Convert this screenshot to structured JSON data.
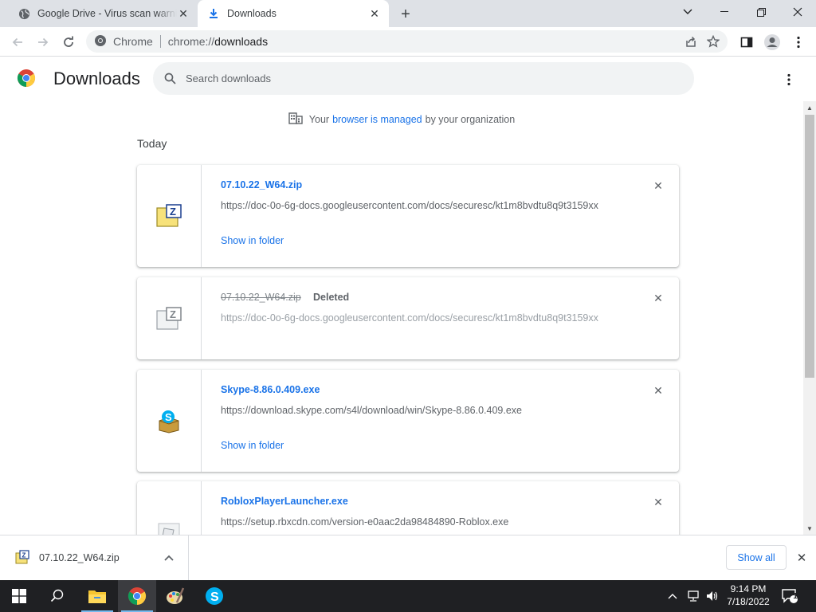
{
  "tabs": [
    {
      "title": "Google Drive - Virus scan warning",
      "icon": "globe-icon"
    },
    {
      "title": "Downloads",
      "icon": "download-icon"
    }
  ],
  "omnibox": {
    "site_label": "Chrome",
    "url_scheme": "chrome://",
    "url_host": "downloads"
  },
  "page": {
    "title": "Downloads",
    "search_placeholder": "Search downloads"
  },
  "managed": {
    "prefix": "Your",
    "link": "browser is managed",
    "suffix": "by your organization"
  },
  "section": "Today",
  "downloads": [
    {
      "name": "07.10.22_W64.zip",
      "url": "https://doc-0o-6g-docs.googleusercontent.com/docs/securesc/kt1m8bvdtu8q9t3159xx",
      "action": "Show in folder",
      "icon": "zip-file-icon"
    },
    {
      "name": "07.10.22_W64.zip",
      "status": "Deleted",
      "url": "https://doc-0o-6g-docs.googleusercontent.com/docs/securesc/kt1m8bvdtu8q9t3159xx",
      "icon": "zip-file-icon"
    },
    {
      "name": "Skype-8.86.0.409.exe",
      "url": "https://download.skype.com/s4l/download/win/Skype-8.86.0.409.exe",
      "action": "Show in folder",
      "icon": "skype-installer-icon"
    },
    {
      "name": "RobloxPlayerLauncher.exe",
      "url": "https://setup.rbxcdn.com/version-e0aac2da98484890-Roblox.exe",
      "icon": "exe-file-icon"
    }
  ],
  "shelf": {
    "file": "07.10.22_W64.zip",
    "show_all": "Show all"
  },
  "taskbar": {
    "time": "9:14 PM",
    "date": "7/18/2022",
    "notifications": "1"
  }
}
